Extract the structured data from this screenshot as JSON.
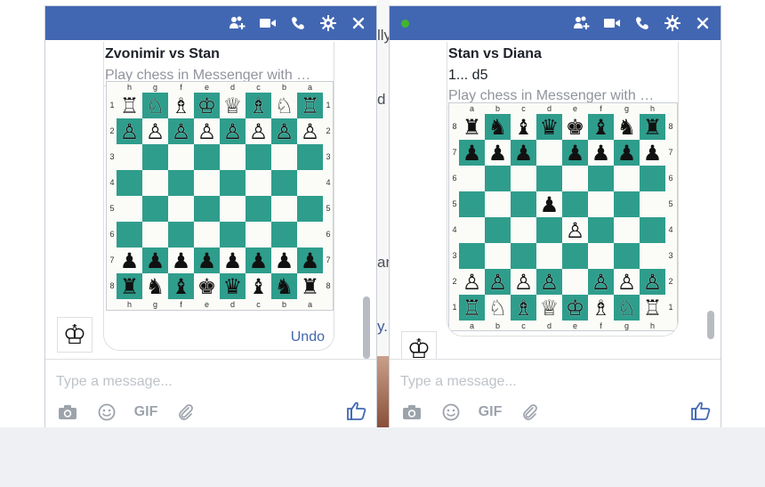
{
  "colors": {
    "header": "#4267b2",
    "dark_square": "#2f9d8c",
    "light_square": "#fbfbf7",
    "link": "#4267b2"
  },
  "background_peek": [
    "lly",
    "d",
    "an",
    "y."
  ],
  "chats": [
    {
      "online": false,
      "header_icons": [
        "add-people-icon",
        "video-call-icon",
        "phone-icon",
        "gear-icon",
        "close-icon"
      ],
      "card": {
        "title": "Zvonimir vs Stan",
        "move": "",
        "subtitle": "Play chess in Messenger with …",
        "files": [
          "h",
          "g",
          "f",
          "e",
          "d",
          "c",
          "b",
          "a"
        ],
        "ranks": [
          "1",
          "2",
          "3",
          "4",
          "5",
          "6",
          "7",
          "8"
        ],
        "board": [
          "♖♘♗♔♕♗♘♖",
          "♙♙♙♙♙♙♙♙",
          "........",
          "........",
          "........",
          "........",
          "♟♟♟♟♟♟♟♟",
          "♜♞♝♚♛♝♞♜"
        ],
        "undo_label": "Undo"
      },
      "avatar_glyph": "♔",
      "composer": {
        "placeholder": "Type a message...",
        "gif_label": "GIF"
      }
    },
    {
      "online": true,
      "header_icons": [
        "add-people-icon",
        "video-call-icon",
        "phone-icon",
        "gear-icon",
        "close-icon"
      ],
      "card": {
        "title": "Stan vs Diana",
        "move": "1... d5",
        "subtitle": "Play chess in Messenger with …",
        "files": [
          "a",
          "b",
          "c",
          "d",
          "e",
          "f",
          "g",
          "h"
        ],
        "ranks": [
          "8",
          "7",
          "6",
          "5",
          "4",
          "3",
          "2",
          "1"
        ],
        "board": [
          "♜♞♝♛♚♝♞♜",
          "♟♟♟.♟♟♟♟",
          "........",
          "...♟....",
          "....♙...",
          "........",
          "♙♙♙♙.♙♙♙",
          "♖♘♗♕♔♗♘♖"
        ],
        "undo_label": ""
      },
      "avatar_glyph": "♔",
      "composer": {
        "placeholder": "Type a message...",
        "gif_label": "GIF"
      }
    }
  ]
}
